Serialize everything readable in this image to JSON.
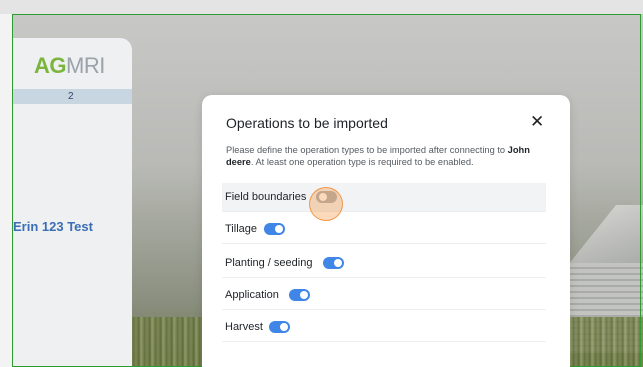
{
  "sidebar": {
    "logo_ag": "AG",
    "logo_mri": "MRI",
    "tab_count": "2",
    "user_name": "Erin 123 Test"
  },
  "modal": {
    "title": "Operations to be imported",
    "close_icon": "close-icon",
    "description_pre": "Please define the operation types to be imported after connecting to ",
    "description_provider": "John deere",
    "description_post": ". At least one operation type is required to be enabled.",
    "operations": [
      {
        "label": "Field boundaries",
        "enabled": false
      },
      {
        "label": "Tillage",
        "enabled": true
      },
      {
        "label": "Planting / seeding",
        "enabled": true
      },
      {
        "label": "Application",
        "enabled": true
      },
      {
        "label": "Harvest",
        "enabled": true
      }
    ]
  },
  "colors": {
    "toggle_on": "#3f86e6",
    "toggle_off": "#aab0b7",
    "accent_green": "#7cb53d",
    "link_blue": "#3b6eb5",
    "click_indicator": "#f0963c"
  }
}
